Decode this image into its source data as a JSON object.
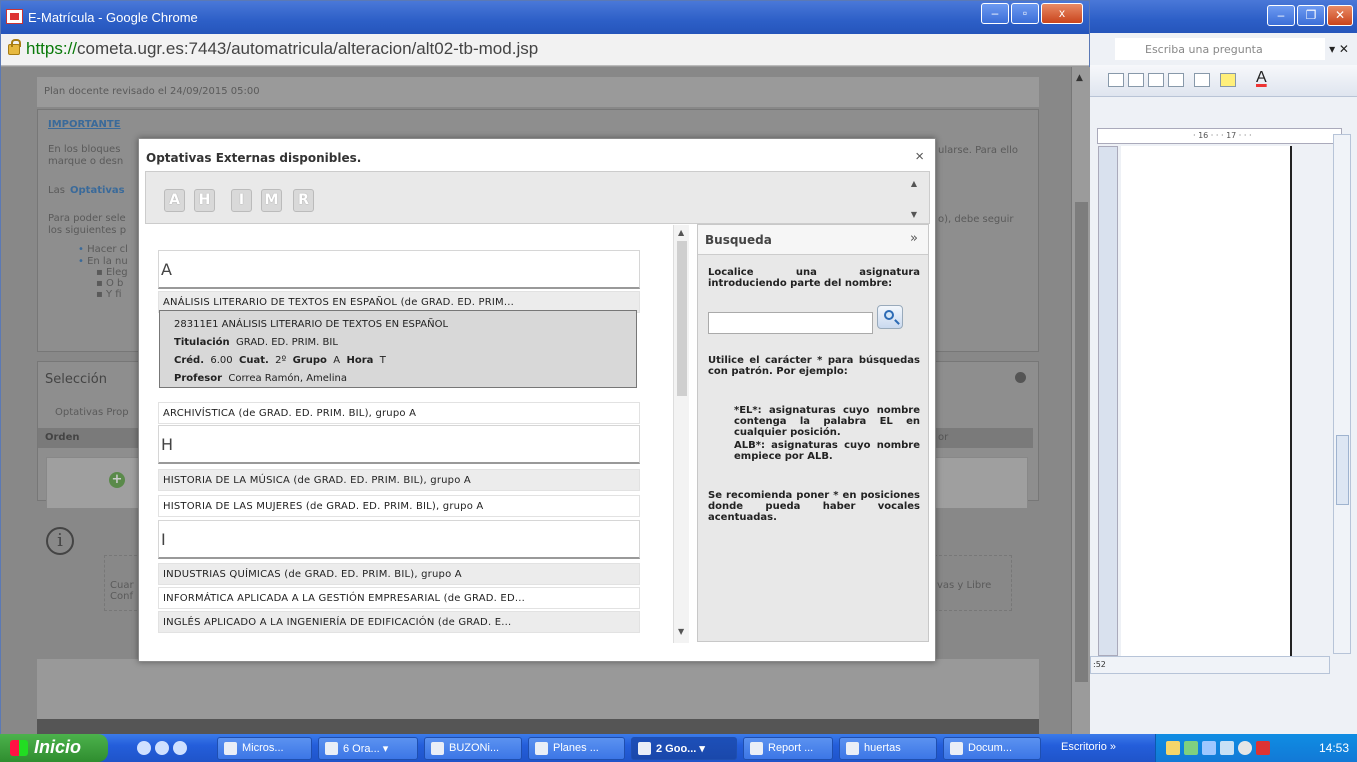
{
  "chrome": {
    "title": "E-Matrícula - Google Chrome",
    "url_scheme": "https://",
    "url_host": "cometa.ugr.es",
    "url_rest": ":7443/automatricula/alteracion/alt02-tb-mod.jsp"
  },
  "background_page": {
    "plan_text": "Plan docente revisado el 24/09/2015 05:00",
    "important_label": "IMPORTANTE",
    "para1_left": "En los bloques",
    "para1_left2": "marque o desn",
    "para1_right": "ularse. Para ello",
    "para2_left": "Las",
    "para2_link": "Optativas",
    "para3_left": "Para poder sele",
    "para3_left2": "los siguientes p",
    "para3_right": "o), debe seguir",
    "bullet1": "Hacer cl",
    "bullet2": "En la nu",
    "sub1": "Eleg",
    "sub2": "O b",
    "sub3": "Y fi",
    "seleccion": "Selección",
    "tab_optativas": "Optativas Prop",
    "col_orden": "Orden",
    "col_or": "or",
    "info_left1": "Cuar",
    "info_left2": "Conf",
    "info_right": "vas y Libre"
  },
  "modal": {
    "title": "Optativas Externas disponibles.",
    "close": "×",
    "letters": [
      "A",
      "H",
      "I",
      "M",
      "R"
    ],
    "groups": [
      {
        "letter": "A",
        "rows": [
          "ANÁLISIS LITERARIO DE TEXTOS EN ESPAÑOL (de GRAD. ED. PRIM...",
          "ARCHIVÍSTICA (de GRAD. ED. PRIM. BIL), grupo A"
        ]
      },
      {
        "letter": "H",
        "rows": [
          "HISTORIA DE LA MÚSICA (de GRAD. ED. PRIM. BIL), grupo A",
          "HISTORIA DE LAS MUJERES (de GRAD. ED. PRIM. BIL), grupo A"
        ]
      },
      {
        "letter": "I",
        "rows": [
          "INDUSTRIAS QUÍMICAS (de GRAD. ED. PRIM. BIL), grupo A",
          "INFORMÁTICA APLICADA A LA GESTIÓN EMPRESARIAL (de GRAD. ED...",
          "INGLÉS APLICADO A LA INGENIERÍA DE EDIFICACIÓN (de GRAD. E..."
        ]
      }
    ],
    "detail": {
      "code_name": "28311E1  ANÁLISIS LITERARIO DE TEXTOS EN ESPAÑOL",
      "titulacion_label": "Titulación",
      "titulacion": "GRAD. ED. PRIM. BIL",
      "cred_label": "Créd.",
      "cred": "6.00",
      "cuat_label": "Cuat.",
      "cuat": "2º",
      "grupo_label": "Grupo",
      "grupo": "A",
      "hora_label": "Hora",
      "hora": "T",
      "profesor_label": "Profesor",
      "profesor": "Correa Ramón, Amelina"
    },
    "search": {
      "title": "Busqueda",
      "collapse": "»",
      "intro": "Localice una asignatura introduciendo parte del nombre:",
      "input_value": "",
      "help1": "Utilice el carácter * para búsquedas con patrón. Por ejemplo:",
      "ex1": "*EL*: asignaturas cuyo nombre contenga la palabra EL en cualquier posición.",
      "ex2": "ALB*: asignaturas cuyo nombre empiece por ALB.",
      "help2": "Se recomienda poner * en posiciones donde pueda haber vocales acentuadas."
    }
  },
  "word": {
    "ask": "Escriba una pregunta",
    "ruler": "· 16 · · · 17 · · ·",
    "status": ":52"
  },
  "taskbar": {
    "start": "Inicio",
    "tasks": [
      "Micros...",
      "6 Ora...",
      "BUZONi...",
      "Planes ...",
      "2 Goo...",
      "Report ...",
      "huertas",
      "Docum..."
    ],
    "escritorio": "Escritorio",
    "clock": "14:53"
  }
}
